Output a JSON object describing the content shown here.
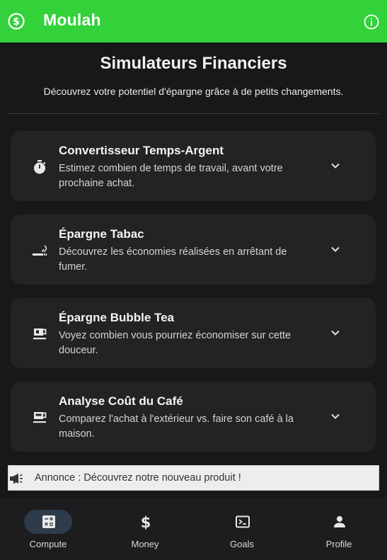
{
  "app": {
    "title": "Moulah",
    "logo_icon": "dollar-circle-icon",
    "info_icon": "info-icon",
    "accent_color": "#33d13a"
  },
  "header": {
    "title": "Simulateurs Financiers",
    "subtitle": "Découvrez votre potentiel d'épargne grâce à de petits changements."
  },
  "cards": [
    {
      "icon": "stopwatch-icon",
      "title": "Convertisseur Temps-Argent",
      "description": "Estimez combien de temps de travail, avant votre prochaine achat."
    },
    {
      "icon": "smoking-icon",
      "title": "Épargne Tabac",
      "description": "Découvrez les économies réalisées en arrêtant de fumer."
    },
    {
      "icon": "cup-icon",
      "title": "Épargne Bubble Tea",
      "description": "Voyez combien vous pourriez économiser sur cette douceur."
    },
    {
      "icon": "coffee-icon",
      "title": "Analyse Coût du Café",
      "description": "Comparez l'achat à l'extérieur vs. faire son café à la maison."
    }
  ],
  "banner": {
    "icon": "megaphone-icon",
    "text": "Annonce : Découvrez notre nouveau produit !"
  },
  "bottom_nav": {
    "active": "Compute",
    "items": [
      {
        "label": "Compute",
        "icon": "calculator-icon"
      },
      {
        "label": "Money",
        "icon": "dollar-icon"
      },
      {
        "label": "Goals",
        "icon": "terminal-icon"
      },
      {
        "label": "Profile",
        "icon": "person-icon"
      }
    ]
  }
}
